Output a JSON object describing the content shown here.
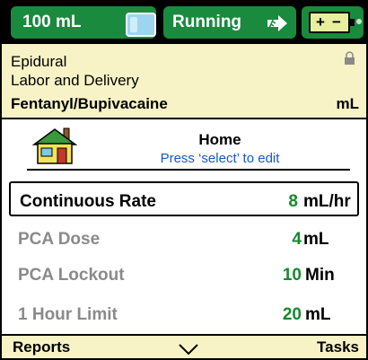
{
  "status": {
    "volume": "100 mL",
    "state": "Running",
    "bag_icon": "iv-bag-icon",
    "run_icon": "running-man-arrow-icon",
    "battery_icon": "battery-icon",
    "battery_plus": "+",
    "battery_minus": "−",
    "accent_color": "#1a8a3e"
  },
  "info": {
    "line1": "Epidural",
    "line2": "Labor and Delivery",
    "drug": "Fentanyl/Bupivacaine",
    "unit": "mL",
    "lock_icon": "lock-icon"
  },
  "home": {
    "title": "Home",
    "hint": "Press ‘select’ to edit",
    "icon": "house-icon"
  },
  "settings": [
    {
      "label": "Continuous Rate",
      "value": "8",
      "unit": "mL/hr",
      "selected": true
    },
    {
      "label": "PCA Dose",
      "value": "4",
      "unit": "mL",
      "selected": false
    },
    {
      "label": "PCA Lockout",
      "value": "10",
      "unit": "Min",
      "selected": false
    },
    {
      "label": "1 Hour Limit",
      "value": "20",
      "unit": "mL",
      "selected": false
    }
  ],
  "softkeys": {
    "left": "Reports",
    "right": "Tasks",
    "center_icon": "down-arrow-icon"
  }
}
